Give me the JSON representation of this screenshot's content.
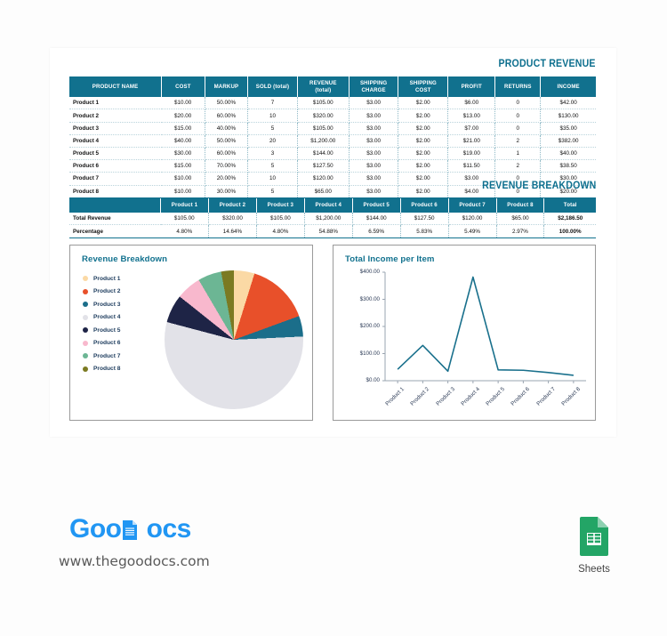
{
  "document": {
    "product_revenue_title": "PRODUCT REVENUE",
    "revenue_breakdown_title": "REVENUE BREAKDOWN"
  },
  "product_table": {
    "headers": [
      "PRODUCT NAME",
      "COST",
      "MARKUP",
      "SOLD (total)",
      "REVENUE (total)",
      "SHIPPING CHARGE",
      "SHIPPING COST",
      "PROFIT",
      "RETURNS",
      "INCOME"
    ],
    "headers_split": [
      [
        "PRODUCT NAME",
        ""
      ],
      [
        "COST",
        ""
      ],
      [
        "MARKUP",
        ""
      ],
      [
        "SOLD (total)",
        ""
      ],
      [
        "REVENUE",
        "(total)"
      ],
      [
        "SHIPPING",
        "CHARGE"
      ],
      [
        "SHIPPING",
        "COST"
      ],
      [
        "PROFIT",
        ""
      ],
      [
        "RETURNS",
        ""
      ],
      [
        "INCOME",
        ""
      ]
    ],
    "rows": [
      {
        "name": "Product 1",
        "cost": "$10.00",
        "markup": "50.00%",
        "sold": "7",
        "revenue": "$105.00",
        "shipping_charge": "$3.00",
        "shipping_cost": "$2.00",
        "profit": "$6.00",
        "returns": "0",
        "income": "$42.00"
      },
      {
        "name": "Product 2",
        "cost": "$20.00",
        "markup": "60.00%",
        "sold": "10",
        "revenue": "$320.00",
        "shipping_charge": "$3.00",
        "shipping_cost": "$2.00",
        "profit": "$13.00",
        "returns": "0",
        "income": "$130.00"
      },
      {
        "name": "Product 3",
        "cost": "$15.00",
        "markup": "40.00%",
        "sold": "5",
        "revenue": "$105.00",
        "shipping_charge": "$3.00",
        "shipping_cost": "$2.00",
        "profit": "$7.00",
        "returns": "0",
        "income": "$35.00"
      },
      {
        "name": "Product 4",
        "cost": "$40.00",
        "markup": "50.00%",
        "sold": "20",
        "revenue": "$1,200.00",
        "shipping_charge": "$3.00",
        "shipping_cost": "$2.00",
        "profit": "$21.00",
        "returns": "2",
        "income": "$382.00"
      },
      {
        "name": "Product 5",
        "cost": "$30.00",
        "markup": "60.00%",
        "sold": "3",
        "revenue": "$144.00",
        "shipping_charge": "$3.00",
        "shipping_cost": "$2.00",
        "profit": "$19.00",
        "returns": "1",
        "income": "$40.00"
      },
      {
        "name": "Product 6",
        "cost": "$15.00",
        "markup": "70.00%",
        "sold": "5",
        "revenue": "$127.50",
        "shipping_charge": "$3.00",
        "shipping_cost": "$2.00",
        "profit": "$11.50",
        "returns": "2",
        "income": "$38.50"
      },
      {
        "name": "Product 7",
        "cost": "$10.00",
        "markup": "20.00%",
        "sold": "10",
        "revenue": "$120.00",
        "shipping_charge": "$3.00",
        "shipping_cost": "$2.00",
        "profit": "$3.00",
        "returns": "0",
        "income": "$30.00"
      },
      {
        "name": "Product 8",
        "cost": "$10.00",
        "markup": "30.00%",
        "sold": "5",
        "revenue": "$65.00",
        "shipping_charge": "$3.00",
        "shipping_cost": "$2.00",
        "profit": "$4.00",
        "returns": "0",
        "income": "$20.00"
      }
    ]
  },
  "breakdown_table": {
    "corner": "",
    "headers": [
      "Product 1",
      "Product 2",
      "Product 3",
      "Product 4",
      "Product 5",
      "Product 6",
      "Product 7",
      "Product 8",
      "Total"
    ],
    "rows": [
      {
        "label": "Total Revenue",
        "values": [
          "$105.00",
          "$320.00",
          "$105.00",
          "$1,200.00",
          "$144.00",
          "$127.50",
          "$120.00",
          "$65.00"
        ],
        "total": "$2,186.50"
      },
      {
        "label": "Percentage",
        "values": [
          "4.80%",
          "14.64%",
          "4.80%",
          "54.88%",
          "6.59%",
          "5.83%",
          "5.49%",
          "2.97%"
        ],
        "total": "100.00%"
      }
    ]
  },
  "chart_data": [
    {
      "type": "pie",
      "title": "Revenue Breakdown",
      "categories": [
        "Product 1",
        "Product 2",
        "Product 3",
        "Product 4",
        "Product 5",
        "Product 6",
        "Product 7",
        "Product 8"
      ],
      "values": [
        4.8,
        14.64,
        4.8,
        54.88,
        6.59,
        5.83,
        5.49,
        2.97
      ],
      "value_unit": "percent",
      "raw_values": [
        105.0,
        320.0,
        105.0,
        1200.0,
        144.0,
        127.5,
        120.0,
        65.0
      ],
      "colors": [
        "#fbd9a5",
        "#e8502a",
        "#1b6e8a",
        "#e2e2e8",
        "#1e2446",
        "#f8b8cd",
        "#6cb694",
        "#7b7a22"
      ],
      "legend_position": "left",
      "start_angle_deg": 0,
      "direction": "clockwise"
    },
    {
      "type": "line",
      "title": "Total Income per Item",
      "x": [
        "Product 1",
        "Product 2",
        "Product 3",
        "Product 4",
        "Product 5",
        "Product 6",
        "Product 7",
        "Product 8"
      ],
      "values": [
        42.0,
        130.0,
        35.0,
        382.0,
        40.0,
        38.5,
        30.0,
        20.0
      ],
      "ylabel": "",
      "xlabel": "",
      "ylim": [
        0,
        400
      ],
      "yticks": [
        "$0.00",
        "$100.00",
        "$200.00",
        "$300.00",
        "$400.00"
      ],
      "grid": false,
      "line_color": "#19708c",
      "legend_position": "none"
    }
  ],
  "footer": {
    "logo_part1": "Goo",
    "logo_part2": "ocs",
    "logo_d": "D",
    "url": "www.thegoodocs.com",
    "sheets_label": "Sheets"
  },
  "colors": {
    "header_teal": "#11718e",
    "title_teal": "#0d6f8e",
    "sheets_green": "#23a566",
    "logo_blue": "#2196f3"
  }
}
